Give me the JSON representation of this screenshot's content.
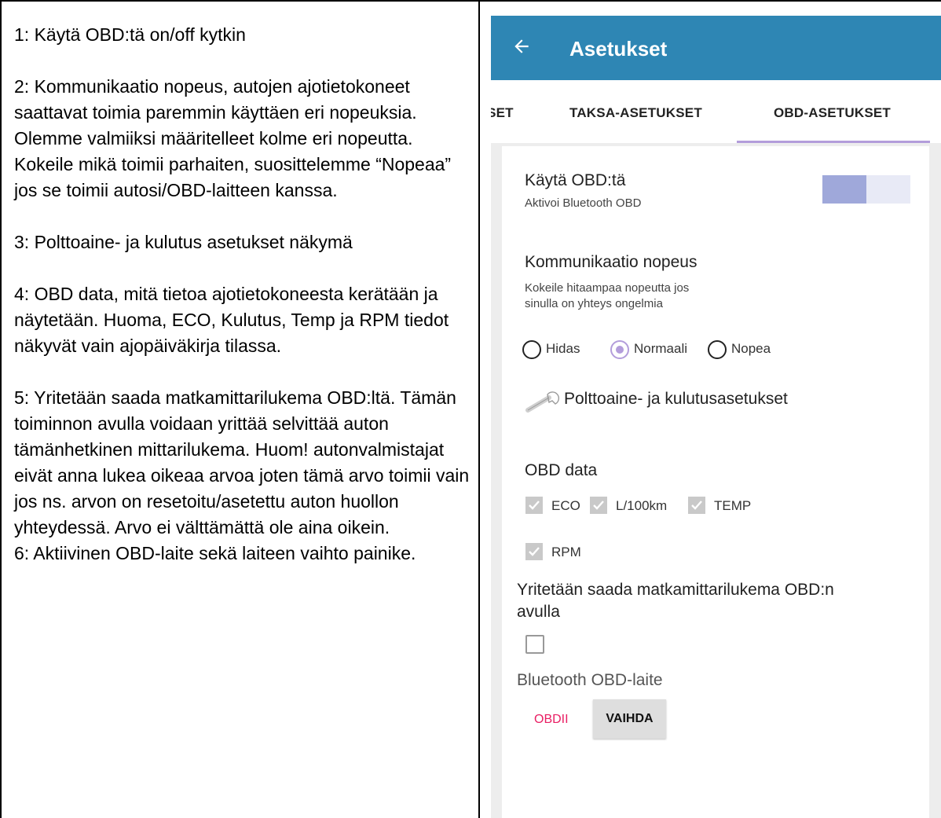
{
  "notes": [
    "1: Käytä OBD:tä on/off kytkin",
    "2: Kommunikaatio nopeus, autojen ajotietokoneet saattavat toimia paremmin käyttäen eri nopeuksia. Olemme valmiiksi määritelleet kolme eri nopeutta. Kokeile mikä toimii parhaiten, suosittelemme “Nopeaa” jos se toimii autosi/OBD-laitteen kanssa.",
    "3: Polttoaine- ja kulutus asetukset näkymä",
    "4: OBD data, mitä tietoa ajotietokoneesta kerätään ja näytetään. Huoma, ECO, Kulutus, Temp ja RPM tiedot näkyvät vain ajopäiväkirja tilassa.",
    "5: Yritetään saada matkamittarilukema OBD:ltä. Tämän toiminnon avulla voidaan yrittää selvittää auton tämänhetkinen mittarilukema. Huom! autonvalmistajat eivät anna lukea oikeaa arvoa joten tämä arvo toimii vain jos ns. arvon on resetoitu/asetettu auton huollon yhteydessä. Arvo ei välttämättä ole aina oikein.",
    "6: Aktiivinen OBD-laite sekä laiteen vaihto painike."
  ],
  "appbar": {
    "title": "Asetukset",
    "back_icon": "arrow-left-icon",
    "color": "#2e86b4"
  },
  "tabs": [
    {
      "label": "ɪSET",
      "active": false
    },
    {
      "label": "TAKSA-ASETUKSET",
      "active": false
    },
    {
      "label": "OBD-ASETUKSET",
      "active": true
    }
  ],
  "settings": {
    "use_obd": {
      "title": "Käytä OBD:tä",
      "subtitle": "Aktivoi Bluetooth OBD",
      "enabled": true
    },
    "speed": {
      "title": "Kommunikaatio nopeus",
      "subtitle_line1": "Kokeile hitaampaa nopeutta jos",
      "subtitle_line2": "sinulla on yhteys ongelmia",
      "options": [
        "Hidas",
        "Normaali",
        "Nopea"
      ],
      "selected": "Normaali"
    },
    "fuel_link": {
      "label": "Polttoaine- ja kulutusasetukset",
      "icon": "wrench-icon"
    },
    "obd_data": {
      "title": "OBD data",
      "items": [
        {
          "label": "ECO",
          "checked": true
        },
        {
          "label": "L/100km",
          "checked": true
        },
        {
          "label": "TEMP",
          "checked": true
        },
        {
          "label": "RPM",
          "checked": true
        }
      ]
    },
    "odometer": {
      "title_line1": "Yritetään saada matkamittarilukema OBD:n",
      "title_line2": "avulla",
      "checked": false
    },
    "bt_device": {
      "title": "Bluetooth OBD-laite",
      "device": "OBDII",
      "change_label": "VAIHDA"
    }
  },
  "colors": {
    "accent": "#b39ddb",
    "device_text": "#e91e63"
  }
}
